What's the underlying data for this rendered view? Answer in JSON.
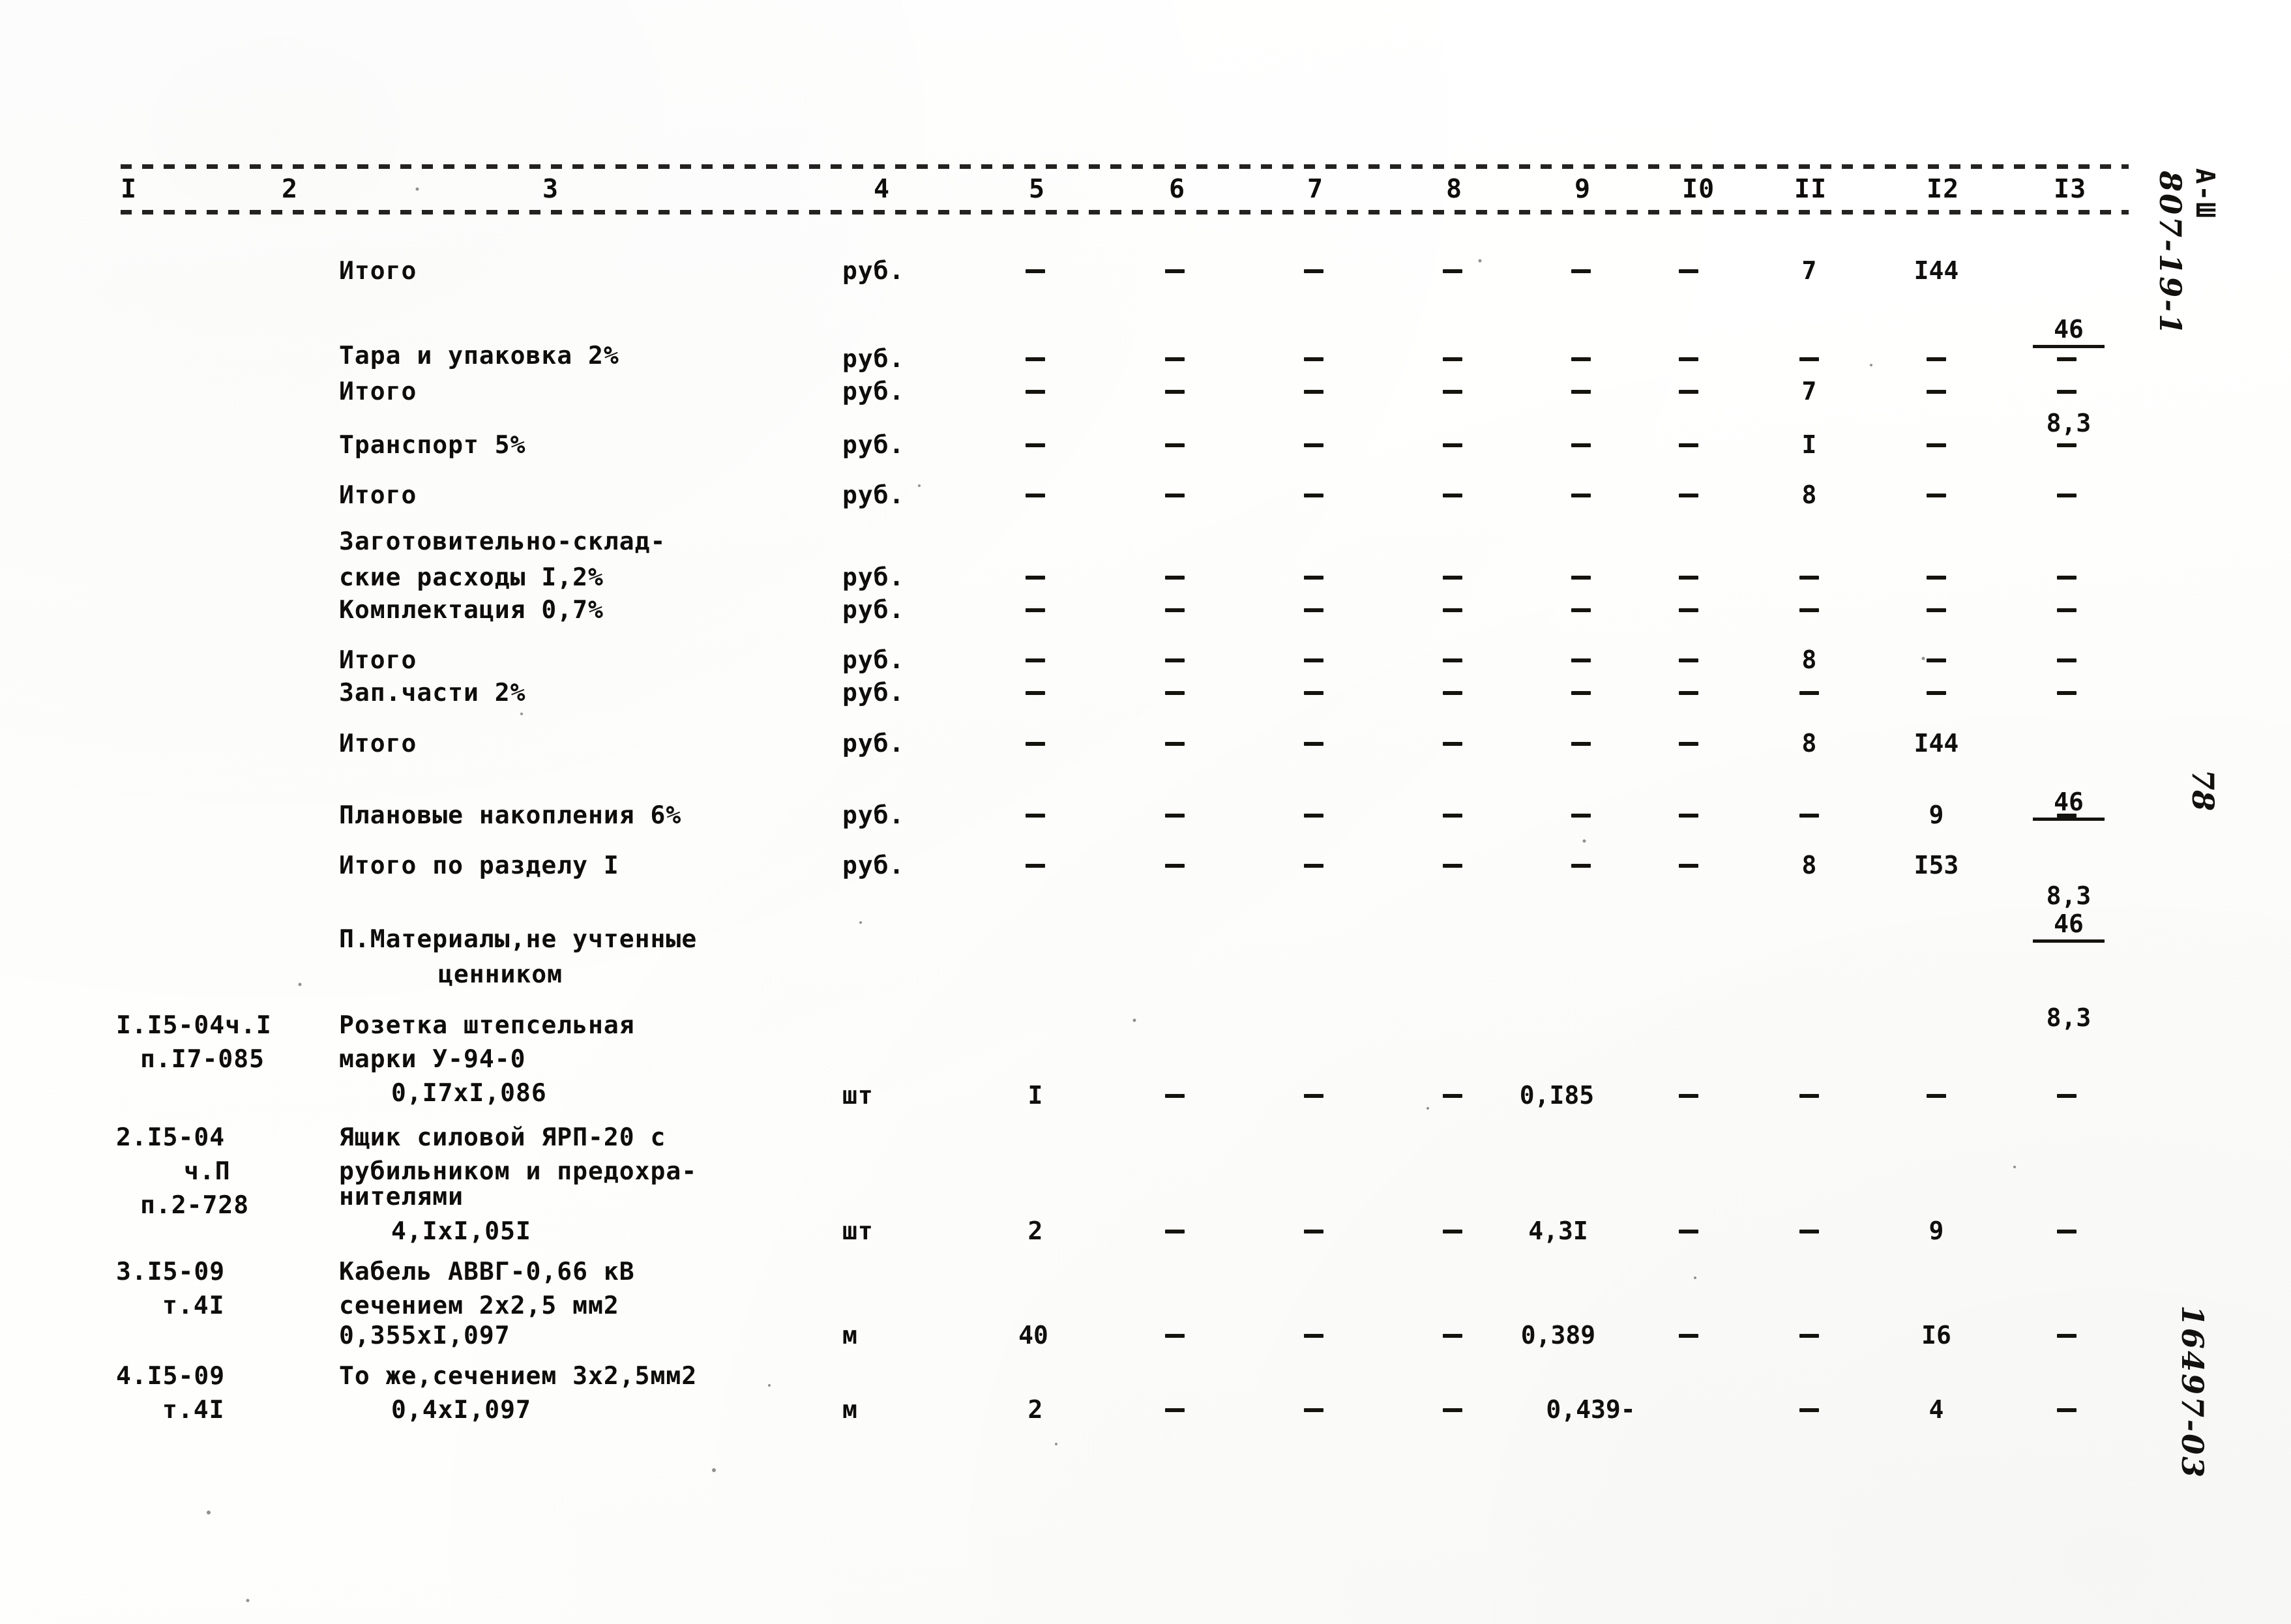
{
  "document": {
    "type": "typewritten-estimate-sheet",
    "language": "ru"
  },
  "column_headers": [
    "I",
    "2",
    "3",
    "4",
    "5",
    "6",
    "7",
    "8",
    "9",
    "I0",
    "II",
    "I2",
    "I3"
  ],
  "summary_rows": [
    {
      "code": "",
      "name": "Итого",
      "unit": "руб.",
      "c5": "-",
      "c6": "-",
      "c7": "-",
      "c8": "-",
      "c9": "-",
      "c10": "-",
      "c11": "7",
      "c12": "I44",
      "c13_numerator": "46",
      "c13_denominator": "8,3"
    },
    {
      "code": "",
      "name": "Тара и упаковка 2%",
      "unit": "руб.",
      "c5": "-",
      "c6": "-",
      "c7": "-",
      "c8": "-",
      "c9": "-",
      "c10": "-",
      "c11": "-",
      "c12": "-",
      "c13": "-"
    },
    {
      "code": "",
      "name": "Итого",
      "unit": "руб.",
      "c5": "-",
      "c6": "-",
      "c7": "-",
      "c8": "-",
      "c9": "-",
      "c10": "-",
      "c11": "7",
      "c12": "-",
      "c13": "-"
    },
    {
      "code": "",
      "name": "Транспорт 5%",
      "unit": "руб.",
      "c5": "-",
      "c6": "-",
      "c7": "-",
      "c8": "-",
      "c9": "-",
      "c10": "-",
      "c11": "I",
      "c12": "-",
      "c13": "-"
    },
    {
      "code": "",
      "name": "Итого",
      "unit": "руб.",
      "c5": "-",
      "c6": "-",
      "c7": "-",
      "c8": "-",
      "c9": "-",
      "c10": "-",
      "c11": "8",
      "c12": "-",
      "c13": "-"
    },
    {
      "code": "",
      "name_line1": "Заготовительно-склад-",
      "name_line2": "ские расходы I,2%",
      "unit": "руб.",
      "c5": "-",
      "c6": "-",
      "c7": "-",
      "c8": "-",
      "c9": "-",
      "c10": "-",
      "c11": "-",
      "c12": "-",
      "c13": "-"
    },
    {
      "code": "",
      "name": "Комплектация 0,7%",
      "unit": "руб.",
      "c5": "-",
      "c6": "-",
      "c7": "-",
      "c8": "-",
      "c9": "-",
      "c10": "-",
      "c11": "-",
      "c12": "-",
      "c13": "-"
    },
    {
      "code": "",
      "name": "Итого",
      "unit": "руб.",
      "c5": "-",
      "c6": "-",
      "c7": "-",
      "c8": "-",
      "c9": "-",
      "c10": "-",
      "c11": "8",
      "c12": "-",
      "c13": "-"
    },
    {
      "code": "",
      "name": "Зап.части 2%",
      "unit": "руб.",
      "c5": "-",
      "c6": "-",
      "c7": "-",
      "c8": "-",
      "c9": "-",
      "c10": "-",
      "c11": "-",
      "c12": "-",
      "c13": "-"
    },
    {
      "code": "",
      "name": "Итого",
      "unit": "руб.",
      "c5": "-",
      "c6": "-",
      "c7": "-",
      "c8": "-",
      "c9": "-",
      "c10": "-",
      "c11": "8",
      "c12": "I44",
      "c13_numerator": "46",
      "c13_denominator": "8,3"
    },
    {
      "code": "",
      "name": "Плановые накопления 6%",
      "unit": "руб.",
      "c5": "-",
      "c6": "-",
      "c7": "-",
      "c8": "-",
      "c9": "-",
      "c10": "-",
      "c11": "-",
      "c12": "9",
      "c13": "-"
    },
    {
      "code": "",
      "name": "Итого по разделу I",
      "unit": "руб.",
      "c5": "-",
      "c6": "-",
      "c7": "-",
      "c8": "-",
      "c9": "-",
      "c10": "-",
      "c11": "8",
      "c12": "I53",
      "c13_numerator": "46",
      "c13_denominator": "8,3"
    }
  ],
  "section_heading": {
    "line1": "П.Материалы,не учтенные",
    "line2": "ценником"
  },
  "item_rows": [
    {
      "code_line1": "I.I5-04ч.I",
      "code_line2": "п.I7-085",
      "name_line1": "Розетка штепсельная",
      "name_line2": "марки У-94-0",
      "name_line3": "0,I7xI,086",
      "unit": "шт",
      "c5": "I",
      "c6": "-",
      "c7": "-",
      "c8": "-",
      "c9": "0,I85",
      "c10": "-",
      "c11": "-",
      "c12": "-",
      "c13": "-"
    },
    {
      "code_line1": "2.I5-04",
      "code_line2": "ч.П",
      "code_line3": "п.2-728",
      "name_line1": "Ящик силовой ЯРП-20 с",
      "name_line2": "рубильником и предохра-",
      "name_line3": "нителями",
      "name_line4": "4,IxI,05I",
      "unit": "шт",
      "c5": "2",
      "c6": "-",
      "c7": "-",
      "c8": "-",
      "c9": "4,3I",
      "c10": "-",
      "c11": "-",
      "c12": "9",
      "c13": "-"
    },
    {
      "code_line1": "3.I5-09",
      "code_line2": "т.4I",
      "name_line1": "Кабель АВВГ-0,66 кВ",
      "name_line2": "сечением 2х2,5 мм2",
      "name_line3": "0,355хI,097",
      "unit": "м",
      "c5": "40",
      "c6": "-",
      "c7": "-",
      "c8": "-",
      "c9": "0,389",
      "c10": "-",
      "c11": "-",
      "c12": "I6",
      "c13": "-"
    },
    {
      "code_line1": "4.I5-09",
      "code_line2": "т.4I",
      "name_line1": "То же,сечением 3х2,5мм2",
      "name_line2": "0,4хI,097",
      "unit": "м",
      "c5": "2",
      "c6": "-",
      "c7": "-",
      "c8": "-",
      "c9": "0,439-",
      "c10": "-",
      "c11": "-",
      "c12": "4",
      "c13": "-"
    }
  ],
  "margin_marks": {
    "doc_code_typed": "А-Ш",
    "doc_number_hand": "807-19-1",
    "page_number": "78",
    "archive_number_hand": "16497-03"
  }
}
